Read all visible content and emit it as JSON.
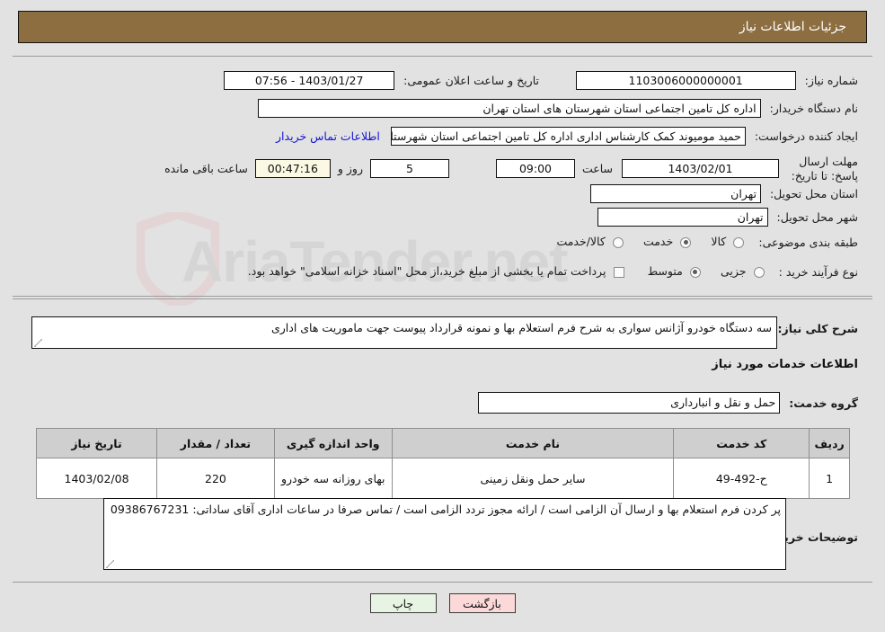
{
  "header": {
    "title": "جزئیات اطلاعات نیاز"
  },
  "watermark": {
    "text": "AriaTender.net"
  },
  "form": {
    "need_number_label": "شماره نیاز:",
    "need_number_value": "1103006000000001",
    "public_announce_label": "تاریخ و ساعت اعلان عمومی:",
    "public_announce_value": "1403/01/27 - 07:56",
    "buyer_org_label": "نام دستگاه خریدار:",
    "buyer_org_value": "اداره کل تامین اجتماعی استان شهرستان های استان تهران",
    "creator_label": "ایجاد کننده درخواست:",
    "creator_value": "حمید مومیوند کمک کارشناس اداری اداره کل تامین اجتماعی استان شهرستان د",
    "buyer_contact_link": "اطلاعات تماس خریدار",
    "deadline_label": "مهلت ارسال پاسخ: تا تاریخ:",
    "deadline_date": "1403/02/01",
    "deadline_hour_label": "ساعت",
    "deadline_hour_value": "09:00",
    "days_value": "5",
    "days_and_label": "روز و",
    "countdown_value": "00:47:16",
    "remaining_label": "ساعت باقی مانده",
    "province_label": "استان محل تحویل:",
    "province_value": "تهران",
    "city_label": "شهر محل تحویل:",
    "city_value": "تهران",
    "category_label": "طبقه بندی موضوعی:",
    "category_options": [
      "کالا",
      "خدمت",
      "کالا/خدمت"
    ],
    "category_selected_index": 1,
    "process_label": "نوع فرآیند خرید :",
    "process_options": [
      "جزیی",
      "متوسط"
    ],
    "process_selected_index": 1,
    "treasury_note": "پرداخت تمام یا بخشی از مبلغ خرید،از محل \"اسناد خزانه اسلامی\" خواهد بود.",
    "treasury_checked": false
  },
  "description": {
    "label": "شرح کلی نیاز:",
    "value": "سه دستگاه خودرو آژانس سواری به شرح فرم استعلام بها و نمونه قرارداد پیوست جهت ماموریت های اداری"
  },
  "services": {
    "section_title": "اطلاعات خدمات مورد نیاز",
    "group_label": "گروه خدمت:",
    "group_value": "حمل و نقل و انبارداری",
    "table": {
      "columns": [
        "ردیف",
        "کد خدمت",
        "نام خدمت",
        "واحد اندازه گیری",
        "تعداد / مقدار",
        "تاریخ نیاز"
      ],
      "rows": [
        {
          "index": "1",
          "code": "ح-492-49",
          "name": "سایر حمل ونقل زمینی",
          "unit": "بهای روزانه سه خودرو",
          "quantity": "220",
          "need_date": "1403/02/08"
        }
      ]
    }
  },
  "buyer_notes": {
    "label": "توضیحات خریدار:",
    "value": "پر کردن فرم استعلام بها و ارسال آن الزامی است / ارائه مجوز تردد الزامی است / تماس صرفا در ساعات اداری آقای ساداتی: 09386767231"
  },
  "buttons": {
    "print": "چاپ",
    "back": "بازگشت"
  },
  "colors": {
    "header_bg": "#8d6e41",
    "page_bg": "#e2e2e2",
    "link": "#1414d6",
    "print_btn_bg": "#e8f4e3",
    "back_btn_bg": "#fbd9d9",
    "countdown_bg": "#fbf9e4"
  }
}
